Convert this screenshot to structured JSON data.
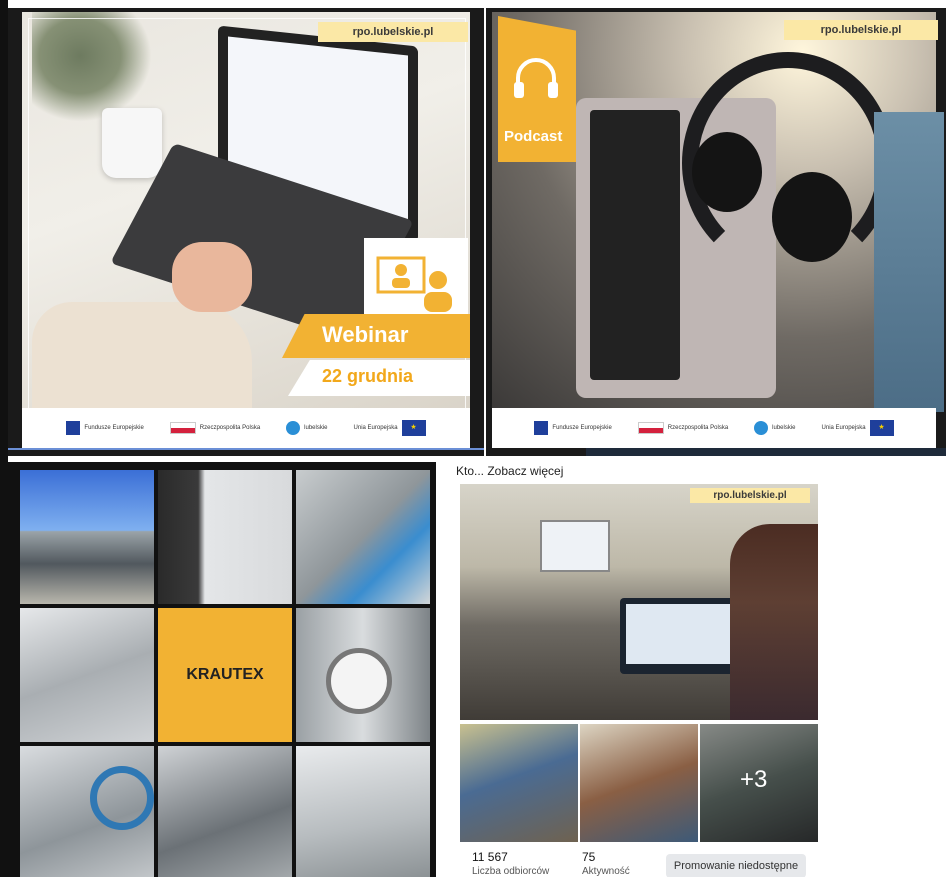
{
  "webinar": {
    "url": "rpo.lubelskie.pl",
    "title": "Webinar",
    "date": "22 grudnia",
    "footer": {
      "fundusze": "Fundusze Europejskie",
      "rp": "Rzeczpospolita Polska",
      "lubelskie": "lubelskie",
      "ue": "Unia Europejska"
    }
  },
  "podcast": {
    "url": "rpo.lubelskie.pl",
    "label": "Podcast",
    "footer": {
      "fundusze": "Fundusze Europejskie",
      "rp": "Rzeczpospolita Polska",
      "lubelskie": "lubelskie",
      "ue": "Unia Europejska"
    }
  },
  "krautex": {
    "label": "KRAUTEX"
  },
  "post": {
    "header": "Kto... Zobacz więcej",
    "url": "rpo.lubelskie.pl",
    "more_photos": "+3",
    "stats": {
      "reach_value": "11 567",
      "reach_label": "Liczba odbiorców",
      "activity_value": "75",
      "activity_label": "Aktywność"
    },
    "promote_button": "Promowanie niedostępne"
  },
  "colors": {
    "accent_yellow": "#f2b233",
    "light_yellow": "#fbe8a6",
    "dark": "#1a1a1a",
    "eu_blue": "#1f3f9b"
  }
}
